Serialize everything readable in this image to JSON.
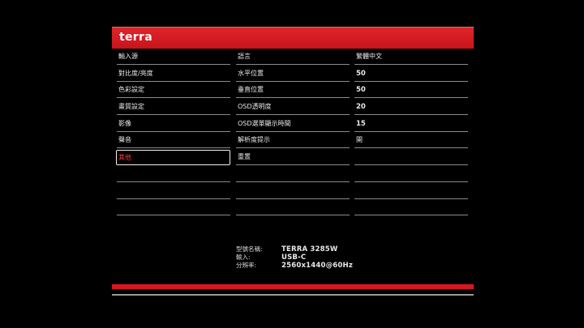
{
  "brand": "terra",
  "menu": {
    "categories": [
      "輸入源",
      "對比度/亮度",
      "色彩設定",
      "畫質設定",
      "影像",
      "聲音",
      "其他"
    ],
    "selected_index": 6,
    "settings": [
      "語言",
      "水平位置",
      "垂直位置",
      "OSD透明度",
      "OSD選單顯示時間",
      "解析度提示",
      "重置"
    ],
    "values": [
      "繁體中文",
      "50",
      "50",
      "20",
      "15",
      "開"
    ]
  },
  "info": {
    "model_label": "型號名稱:",
    "model_value": "TERRA 3285W",
    "input_label": "輸入:",
    "input_value": "USB-C",
    "resolution_label": "分辨率:",
    "resolution_value": "2560x1440@60Hz"
  },
  "colors": {
    "accent": "#d8161e",
    "background": "#000000"
  }
}
